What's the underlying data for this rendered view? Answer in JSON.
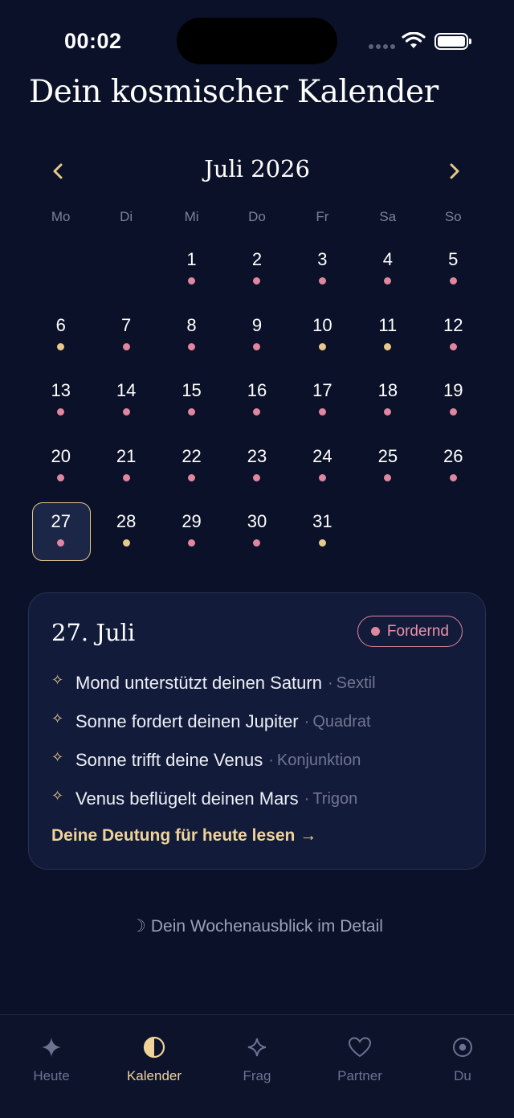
{
  "status": {
    "time": "00:02"
  },
  "title": "Dein kosmischer Kalender",
  "month": {
    "title": "Juli 2026",
    "prev": "‹",
    "next": "›"
  },
  "weekdays": [
    "Mo",
    "Di",
    "Mi",
    "Do",
    "Fr",
    "Sa",
    "So"
  ],
  "colors": {
    "pink": "#e0869f",
    "gold": "#e8c98c",
    "background": "#0b1128",
    "card": "#121b3a"
  },
  "calendar": {
    "leading_blanks": 2,
    "selected": 27,
    "days": [
      {
        "n": "1",
        "dot": "pink"
      },
      {
        "n": "2",
        "dot": "pink"
      },
      {
        "n": "3",
        "dot": "pink"
      },
      {
        "n": "4",
        "dot": "pink"
      },
      {
        "n": "5",
        "dot": "pink"
      },
      {
        "n": "6",
        "dot": "gold"
      },
      {
        "n": "7",
        "dot": "pink"
      },
      {
        "n": "8",
        "dot": "pink"
      },
      {
        "n": "9",
        "dot": "pink"
      },
      {
        "n": "10",
        "dot": "gold"
      },
      {
        "n": "11",
        "dot": "gold"
      },
      {
        "n": "12",
        "dot": "pink"
      },
      {
        "n": "13",
        "dot": "pink"
      },
      {
        "n": "14",
        "dot": "pink"
      },
      {
        "n": "15",
        "dot": "pink"
      },
      {
        "n": "16",
        "dot": "pink"
      },
      {
        "n": "17",
        "dot": "pink"
      },
      {
        "n": "18",
        "dot": "pink"
      },
      {
        "n": "19",
        "dot": "pink"
      },
      {
        "n": "20",
        "dot": "pink"
      },
      {
        "n": "21",
        "dot": "pink"
      },
      {
        "n": "22",
        "dot": "pink"
      },
      {
        "n": "23",
        "dot": "pink"
      },
      {
        "n": "24",
        "dot": "pink"
      },
      {
        "n": "25",
        "dot": "pink"
      },
      {
        "n": "26",
        "dot": "pink"
      },
      {
        "n": "27",
        "dot": "pink"
      },
      {
        "n": "28",
        "dot": "gold"
      },
      {
        "n": "29",
        "dot": "pink"
      },
      {
        "n": "30",
        "dot": "pink"
      },
      {
        "n": "31",
        "dot": "gold"
      }
    ]
  },
  "detail": {
    "date": "27. Juli",
    "badge": "Fordernd",
    "aspects": [
      {
        "text": "Mond unterstützt deinen Saturn",
        "sep": "·",
        "type": "Sextil"
      },
      {
        "text": "Sonne fordert deinen Jupiter",
        "sep": "·",
        "type": "Quadrat"
      },
      {
        "text": "Sonne trifft deine Venus",
        "sep": "·",
        "type": "Konjunktion"
      },
      {
        "text": "Venus beflügelt deinen Mars",
        "sep": "·",
        "type": "Trigon"
      }
    ],
    "spark": "✧",
    "link": "Deine Deutung für heute lesen →"
  },
  "week_link": {
    "moon": "☽",
    "label": "Dein Wochenausblick im Detail"
  },
  "tabs": [
    {
      "label": "Heute",
      "icon": "sparkle-icon",
      "active": false
    },
    {
      "label": "Kalender",
      "icon": "half-moon-icon",
      "active": true
    },
    {
      "label": "Frag",
      "icon": "star-outline-icon",
      "active": false
    },
    {
      "label": "Partner",
      "icon": "heart-icon",
      "active": false
    },
    {
      "label": "Du",
      "icon": "target-icon",
      "active": false
    }
  ]
}
